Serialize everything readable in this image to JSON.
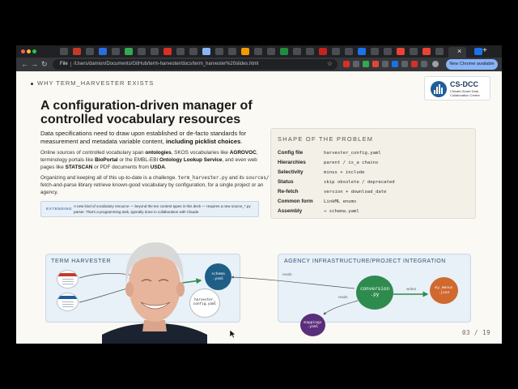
{
  "browser": {
    "tabs": [
      "",
      "",
      "",
      ""
    ],
    "url": "/Users/damion/Documents/GitHub/term-harvester/docs/term_harvester%20slides.html",
    "scheme_label": "File",
    "update_label": "New Chrome available",
    "close_glyph": "×",
    "new_tab_glyph": "+",
    "back_glyph": "←",
    "forward_glyph": "→",
    "reload_glyph": "↻",
    "star_glyph": "☆",
    "menu_glyph": "⋮",
    "colors": {
      "frame": "#202124",
      "toolbar": "#35363a",
      "omnibox": "#202124",
      "update": "#8ab4f8"
    }
  },
  "slide": {
    "kicker": "WHY TERM_HARVESTER EXISTS",
    "logo": {
      "name": "CS-DCC",
      "subtitle": "Climate-Smart Data Collaboration Centre"
    },
    "title": "A configuration-driven manager of controlled vocabulary resources",
    "lede": {
      "text": "Data specifications need to draw upon established or de-facto standards for measurement and metadata variable content, ",
      "bold": "including picklist choices",
      "end": "."
    },
    "p1": {
      "a": "Online sources of controlled vocabulary span ",
      "b1": "ontologies",
      "c": ", SKOS vocabularies like ",
      "b2": "AGROVOC",
      "d": ", terminology portals like ",
      "b3": "BioPortal",
      "e": " or the EMBL-EBI ",
      "b4": "Ontology Lookup Service",
      "f": ", and even web pages like ",
      "b5": "STATSCAN",
      "g": " or PDF documents from ",
      "b6": "USDA",
      "h": "."
    },
    "p2": {
      "a": "Organizing and keeping all of this up-to-date is a challenge. ",
      "code1": "term_harvester.py",
      "b": " and its ",
      "code2": "sources/",
      "c": " fetch-and-parse library retrieve known-good vocabulary by configuration, for a single project or an agency."
    },
    "note": {
      "tag": "EXTENDING",
      "text": "A new kind of vocabulary resource — beyond the ten content types in this deck — requires a new source_*.py parser. That's a programming task, typically done in collaboration with Claude."
    },
    "problem": {
      "heading": "SHAPE OF THE PROBLEM",
      "rows": [
        {
          "k": "Config file",
          "v": "harvester_config.yaml"
        },
        {
          "k": "Hierarchies",
          "v": "parent / is_a chains"
        },
        {
          "k": "Selectivity",
          "v": "minus + include"
        },
        {
          "k": "Status",
          "v": "skip obsolete / deprecated"
        },
        {
          "k": "Re-fetch",
          "v": "version + download_date"
        },
        {
          "k": "Common form",
          "v": "LinkML enums"
        },
        {
          "k": "Assembly",
          "v": "→ schema.yaml"
        }
      ]
    },
    "diagram_left": {
      "label": "TERM HARVESTER",
      "nodes": {
        "schema": "schema\n.yaml",
        "config": "harvester_\nconfig.yaml"
      }
    },
    "diagram_right": {
      "label": "AGENCY INFRASTRUCTURE/PROJECT INTEGRATION",
      "nodes": {
        "conversion": "conversion\n.py",
        "mappings": "mappings\n.yaml",
        "menus": "my_menus\n.json"
      },
      "edges": {
        "reads_top": "reads",
        "reads_mid": "reads",
        "writes": "writes"
      }
    },
    "page_number": "03 / 19",
    "colors": {
      "background": "#fbf9f3",
      "schema_node": "#1f5f86",
      "conversion_node": "#2e8b4e",
      "mappings_node": "#5a2e7a",
      "menus_node": "#d0692e",
      "accent_blue": "#1e5e9a"
    }
  }
}
